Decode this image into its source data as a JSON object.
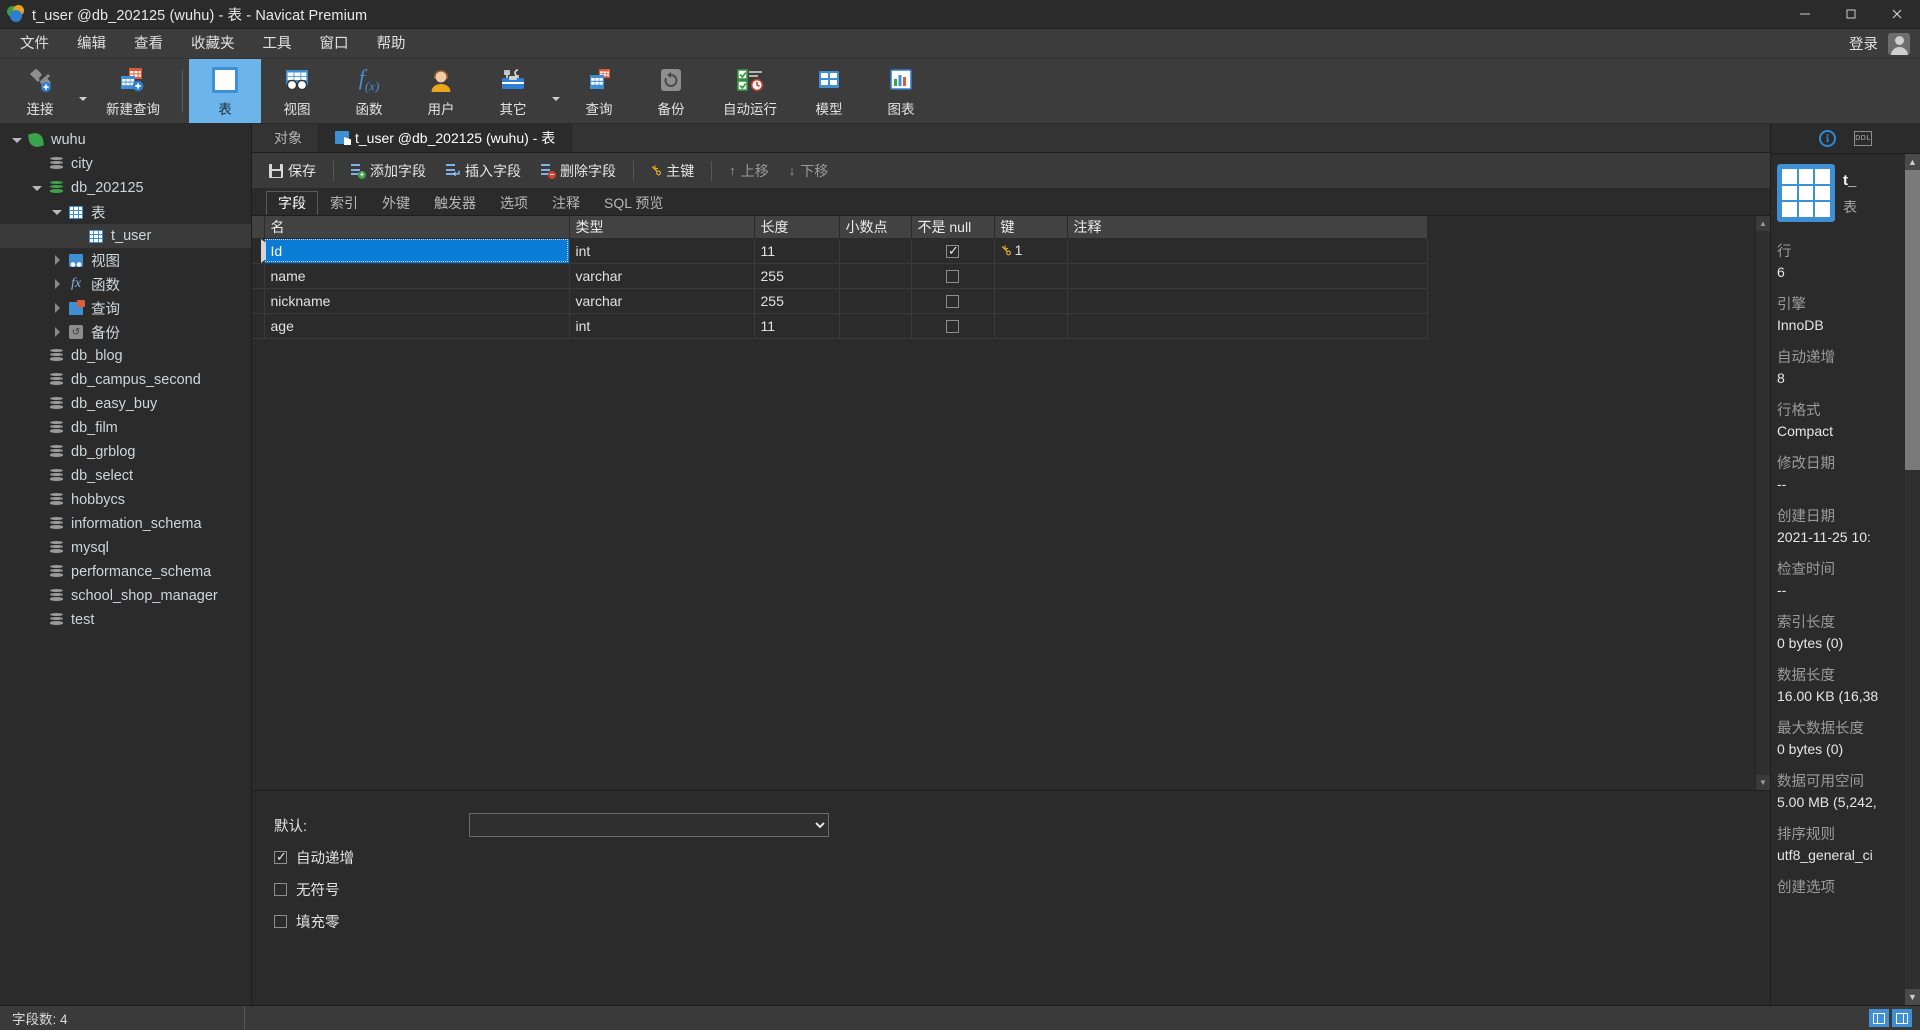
{
  "window": {
    "title": "t_user @db_202125 (wuhu) - 表 - Navicat Premium",
    "minimize": "—",
    "maximize": "▢",
    "close": "✕"
  },
  "menubar": {
    "items": [
      "文件",
      "编辑",
      "查看",
      "收藏夹",
      "工具",
      "窗口",
      "帮助"
    ],
    "login": "登录"
  },
  "ribbon": {
    "groups": [
      {
        "label": "连接",
        "icon": "connection-icon",
        "caret": true
      },
      {
        "label": "新建查询",
        "icon": "new-query-icon",
        "caret": false
      }
    ],
    "items": [
      {
        "label": "表",
        "icon": "table-icon",
        "active": true,
        "caret": false
      },
      {
        "label": "视图",
        "icon": "view-icon",
        "active": false,
        "caret": false
      },
      {
        "label": "函数",
        "icon": "function-icon",
        "active": false,
        "caret": false
      },
      {
        "label": "用户",
        "icon": "user-icon",
        "active": false,
        "caret": false
      },
      {
        "label": "其它",
        "icon": "other-icon",
        "active": false,
        "caret": true
      },
      {
        "label": "查询",
        "icon": "query-icon",
        "active": false,
        "caret": false
      },
      {
        "label": "备份",
        "icon": "backup-icon",
        "active": false,
        "caret": false
      },
      {
        "label": "自动运行",
        "icon": "automation-icon",
        "active": false,
        "caret": false
      },
      {
        "label": "模型",
        "icon": "model-icon",
        "active": false,
        "caret": false
      },
      {
        "label": "图表",
        "icon": "chart-icon",
        "active": false,
        "caret": false
      }
    ]
  },
  "sidebar": {
    "nodes": [
      {
        "label": "wuhu",
        "depth": 0,
        "icon": "connection-leaf-icon",
        "twisty": "expanded",
        "selected": false
      },
      {
        "label": "city",
        "depth": 1,
        "icon": "database-icon",
        "twisty": "none",
        "selected": false
      },
      {
        "label": "db_202125",
        "depth": 1,
        "icon": "database-active-icon",
        "twisty": "expanded",
        "selected": false
      },
      {
        "label": "表",
        "depth": 2,
        "icon": "table-folder-icon",
        "twisty": "expanded",
        "selected": false
      },
      {
        "label": "t_user",
        "depth": 3,
        "icon": "table-icon",
        "twisty": "none",
        "selected": true
      },
      {
        "label": "视图",
        "depth": 2,
        "icon": "views-icon",
        "twisty": "collapsed",
        "selected": false
      },
      {
        "label": "函数",
        "depth": 2,
        "icon": "functions-icon",
        "twisty": "collapsed",
        "selected": false
      },
      {
        "label": "查询",
        "depth": 2,
        "icon": "queries-icon",
        "twisty": "collapsed",
        "selected": false
      },
      {
        "label": "备份",
        "depth": 2,
        "icon": "backups-icon",
        "twisty": "collapsed",
        "selected": false
      },
      {
        "label": "db_blog",
        "depth": 1,
        "icon": "database-icon",
        "twisty": "none",
        "selected": false
      },
      {
        "label": "db_campus_second",
        "depth": 1,
        "icon": "database-icon",
        "twisty": "none",
        "selected": false
      },
      {
        "label": "db_easy_buy",
        "depth": 1,
        "icon": "database-icon",
        "twisty": "none",
        "selected": false
      },
      {
        "label": "db_film",
        "depth": 1,
        "icon": "database-icon",
        "twisty": "none",
        "selected": false
      },
      {
        "label": "db_grblog",
        "depth": 1,
        "icon": "database-icon",
        "twisty": "none",
        "selected": false
      },
      {
        "label": "db_select",
        "depth": 1,
        "icon": "database-icon",
        "twisty": "none",
        "selected": false
      },
      {
        "label": "hobbycs",
        "depth": 1,
        "icon": "database-icon",
        "twisty": "none",
        "selected": false
      },
      {
        "label": "information_schema",
        "depth": 1,
        "icon": "database-icon",
        "twisty": "none",
        "selected": false
      },
      {
        "label": "mysql",
        "depth": 1,
        "icon": "database-icon",
        "twisty": "none",
        "selected": false
      },
      {
        "label": "performance_schema",
        "depth": 1,
        "icon": "database-icon",
        "twisty": "none",
        "selected": false
      },
      {
        "label": "school_shop_manager",
        "depth": 1,
        "icon": "database-icon",
        "twisty": "none",
        "selected": false
      },
      {
        "label": "test",
        "depth": 1,
        "icon": "database-icon",
        "twisty": "none",
        "selected": false
      }
    ]
  },
  "tabs": [
    {
      "label": "对象",
      "active": false,
      "icon": "none"
    },
    {
      "label": "t_user @db_202125 (wuhu) - 表",
      "active": true,
      "icon": "table-designer-icon"
    }
  ],
  "actionbar": [
    {
      "label": "保存",
      "icon": "save-icon",
      "dim": false
    },
    {
      "label": "添加字段",
      "icon": "add-field-icon",
      "dim": false
    },
    {
      "label": "插入字段",
      "icon": "insert-field-icon",
      "dim": false
    },
    {
      "label": "删除字段",
      "icon": "delete-field-icon",
      "dim": false
    },
    {
      "label": "主键",
      "icon": "primary-key-icon",
      "dim": false
    },
    {
      "label": "上移",
      "icon": "move-up-icon",
      "dim": true
    },
    {
      "label": "下移",
      "icon": "move-down-icon",
      "dim": true
    }
  ],
  "subtabs": [
    {
      "label": "字段",
      "active": true
    },
    {
      "label": "索引",
      "active": false
    },
    {
      "label": "外键",
      "active": false
    },
    {
      "label": "触发器",
      "active": false
    },
    {
      "label": "选项",
      "active": false
    },
    {
      "label": "注释",
      "active": false
    },
    {
      "label": "SQL 预览",
      "active": false
    }
  ],
  "grid": {
    "columns": [
      "名",
      "类型",
      "长度",
      "小数点",
      "不是 null",
      "键",
      "注释"
    ],
    "rows": [
      {
        "name": "Id",
        "type": "int",
        "length": "11",
        "decimals": "",
        "notnull": true,
        "key": "1",
        "comment": "",
        "selected": true
      },
      {
        "name": "name",
        "type": "varchar",
        "length": "255",
        "decimals": "",
        "notnull": false,
        "key": "",
        "comment": "",
        "selected": false
      },
      {
        "name": "nickname",
        "type": "varchar",
        "length": "255",
        "decimals": "",
        "notnull": false,
        "key": "",
        "comment": "",
        "selected": false
      },
      {
        "name": "age",
        "type": "int",
        "length": "11",
        "decimals": "",
        "notnull": false,
        "key": "",
        "comment": "",
        "selected": false
      }
    ]
  },
  "properties": {
    "default_label": "默认:",
    "default_value": "",
    "checkboxes": [
      {
        "label": "自动递增",
        "checked": true
      },
      {
        "label": "无符号",
        "checked": false
      },
      {
        "label": "填充零",
        "checked": false
      }
    ]
  },
  "info_panel": {
    "object_name": "t_",
    "object_type": "表",
    "fields": [
      {
        "key": "行",
        "value": "6"
      },
      {
        "key": "引擎",
        "value": "InnoDB"
      },
      {
        "key": "自动递增",
        "value": "8"
      },
      {
        "key": "行格式",
        "value": "Compact"
      },
      {
        "key": "修改日期",
        "value": "--"
      },
      {
        "key": "创建日期",
        "value": "2021-11-25 10:"
      },
      {
        "key": "检查时间",
        "value": "--"
      },
      {
        "key": "索引长度",
        "value": "0 bytes (0)"
      },
      {
        "key": "数据长度",
        "value": "16.00 KB (16,38"
      },
      {
        "key": "最大数据长度",
        "value": "0 bytes (0)"
      },
      {
        "key": "数据可用空间",
        "value": "5.00 MB (5,242,"
      },
      {
        "key": "排序规则",
        "value": "utf8_general_ci"
      },
      {
        "key": "创建选项",
        "value": ""
      }
    ]
  },
  "statusbar": {
    "field_count": "字段数: 4"
  },
  "colors": {
    "accent": "#3f8fd4",
    "selection": "#0a7cd6",
    "ribbon_active": "#6cb4ea",
    "key_yellow": "#e8b225",
    "background": "#2b2b2b"
  }
}
